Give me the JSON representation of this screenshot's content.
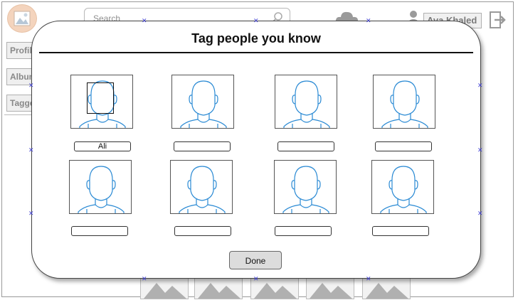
{
  "header": {
    "search_placeholder": "Search",
    "user_name": "Ava Khaled"
  },
  "sidebar": {
    "items": [
      {
        "label": "Profile"
      },
      {
        "label": "Albums"
      },
      {
        "label": "Tagged"
      }
    ]
  },
  "modal": {
    "title": "Tag people you know",
    "done_label": "Done",
    "tags": [
      "Ali",
      "",
      "",
      "",
      "",
      "",
      "",
      ""
    ]
  },
  "colors": {
    "avatar_stroke": "#2a8ad4",
    "modal_border": "#444444",
    "handle": "#3a3ad0"
  },
  "icons": [
    "image-icon",
    "search-icon",
    "cloud-icon",
    "user-icon",
    "logout-icon",
    "person-placeholder-icon",
    "landscape-image-icon"
  ]
}
